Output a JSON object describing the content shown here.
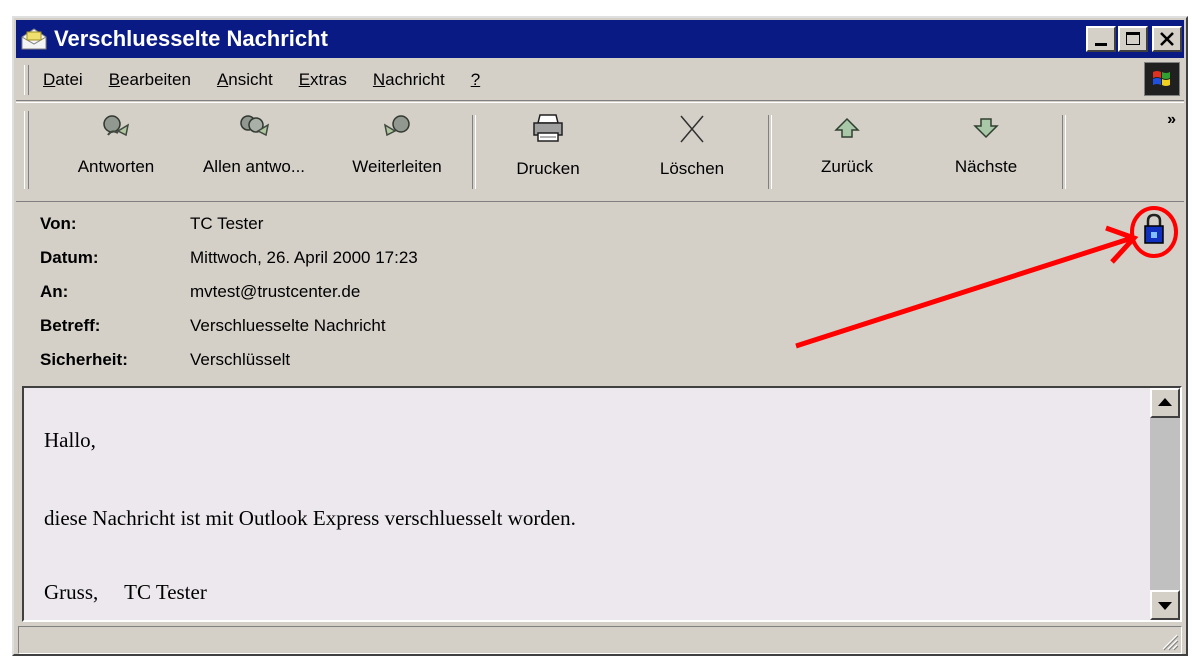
{
  "window": {
    "title": "Verschluesselte Nachricht"
  },
  "menu": {
    "items": [
      {
        "underline": "D",
        "rest": "atei"
      },
      {
        "underline": "B",
        "rest": "earbeiten"
      },
      {
        "underline": "A",
        "rest": "nsicht"
      },
      {
        "underline": "E",
        "rest": "xtras"
      },
      {
        "underline": "N",
        "rest": "achricht"
      },
      {
        "underline": "?",
        "rest": ""
      }
    ]
  },
  "toolbar": {
    "reply": "Antworten",
    "reply_all": "Allen antwo...",
    "forward": "Weiterleiten",
    "print": "Drucken",
    "delete": "Löschen",
    "previous": "Zurück",
    "next": "Nächste",
    "more": "»"
  },
  "header": {
    "from_label": "Von:",
    "from_value": "TC Tester",
    "date_label": "Datum:",
    "date_value": "Mittwoch, 26. April 2000 17:23",
    "to_label": "An:",
    "to_value": "mvtest@trustcenter.de",
    "subject_label": "Betreff:",
    "subject_value": "Verschluesselte Nachricht",
    "security_label": "Sicherheit:",
    "security_value": "Verschlüsselt"
  },
  "body": {
    "line1": "Hallo,",
    "line2": "diese Nachricht ist mit Outlook Express verschluesselt worden.",
    "line3": "Gruss,     TC Tester"
  },
  "colors": {
    "titlebar": "#0a1a84",
    "window_face": "#d4d0c8",
    "body_bg": "#ece8ee",
    "annotation": "#ff0000",
    "lock": "#1030c0"
  }
}
